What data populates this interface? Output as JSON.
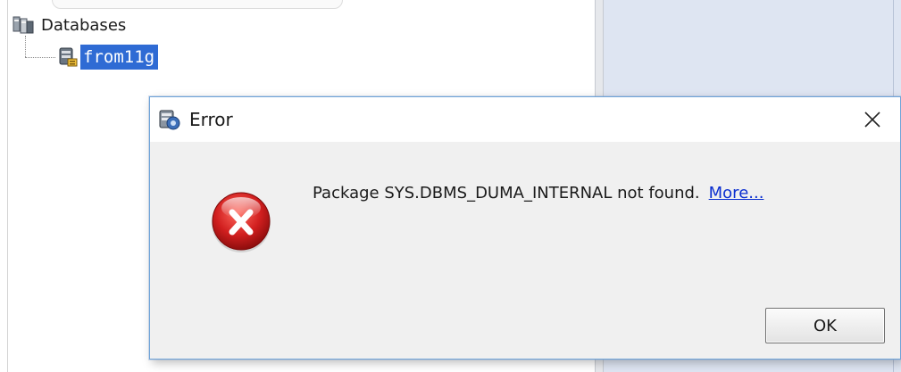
{
  "tree": {
    "root_label": "Databases",
    "root_icon": "databases-icon",
    "child_label": "from11g",
    "child_icon": "database-connection-icon"
  },
  "dialog": {
    "title": "Error",
    "title_icon": "app-dialog-icon",
    "close_icon": "close-icon",
    "error_icon": "error-icon",
    "message": "Package SYS.DBMS_DUMA_INTERNAL not found.",
    "more_link": "More...",
    "ok_label": "OK"
  },
  "colors": {
    "selection": "#2f6bd4",
    "link": "#0b2fd0",
    "error_red": "#d11f1f",
    "dialog_border": "#6fa3d8",
    "right_panel": "#dee5f2"
  }
}
